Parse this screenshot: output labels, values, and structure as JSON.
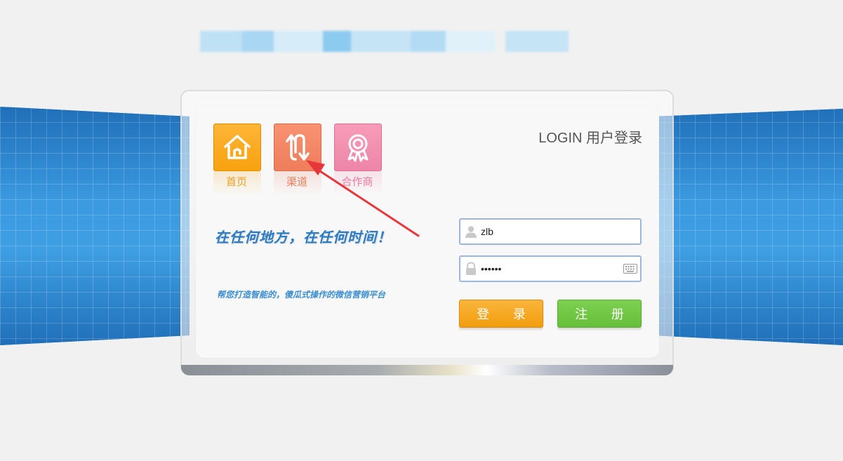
{
  "header": {
    "logo_text": "",
    "logo_colors": [
      "#bfe1f5",
      "#a9d6f2",
      "#d6ecf8",
      "#8ccaef",
      "#c5e4f6",
      "#b3dbf4",
      "#e0f1fa",
      "#9fd2f1"
    ]
  },
  "nav": {
    "items": [
      {
        "label": "首页",
        "icon": "home-icon",
        "color": "#f7a20f"
      },
      {
        "label": "渠道",
        "icon": "channel-arrows-icon",
        "color": "#ee7d5b"
      },
      {
        "label": "合作商",
        "icon": "award-ribbon-icon",
        "color": "#ee85a8"
      }
    ]
  },
  "login": {
    "title": "LOGIN 用户登录",
    "username_value": "zlb",
    "password_value": "••••••",
    "login_button": "登 录",
    "register_button": "注 册"
  },
  "slogan": {
    "main": "在任何地方，在任何时间！",
    "sub": "帮您打造智能的，傻瓜式操作的微信营销平台"
  },
  "annotation": {
    "arrow_color": "#e8363b"
  },
  "theme": {
    "band_color": "#2e86cf",
    "orange": "#f29d0d",
    "green": "#66bf3a",
    "field_border": "#9bb7dd"
  }
}
